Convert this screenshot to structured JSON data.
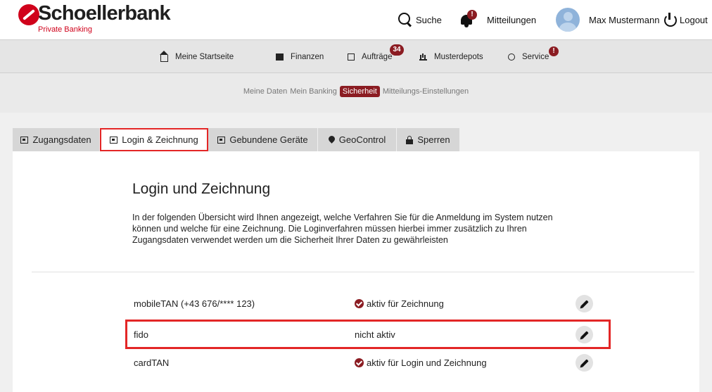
{
  "brand": {
    "name": "Schoellerbank",
    "subtitle": "Private Banking"
  },
  "header": {
    "search_label": "Suche",
    "notifications_label": "Mitteilungen",
    "notifications_badge": "!",
    "user_name": "Max Mustermann",
    "logout_label": "Logout"
  },
  "main_nav": [
    {
      "label": "Meine Startseite",
      "icon": "home-icon"
    },
    {
      "label": "Finanzen",
      "icon": "finance-icon"
    },
    {
      "label": "Aufträge",
      "icon": "orders-icon",
      "badge": "34"
    },
    {
      "label": "Musterdepots",
      "icon": "chart-bars-icon"
    },
    {
      "label": "Service",
      "icon": "service-icon",
      "badge": "!"
    }
  ],
  "sub_nav": {
    "items": [
      "Meine Daten",
      "Mein Banking",
      "Sicherheit",
      "Mitteilungs-Einstellungen"
    ],
    "active": "Sicherheit"
  },
  "tabs": [
    {
      "label": "Zugangsdaten",
      "icon": "id-card-icon"
    },
    {
      "label": "Login & Zeichnung",
      "icon": "id-card-icon",
      "active": true
    },
    {
      "label": "Gebundene Geräte",
      "icon": "id-card-icon"
    },
    {
      "label": "GeoControl",
      "icon": "map-pin-icon"
    },
    {
      "label": "Sperren",
      "icon": "lock-icon"
    }
  ],
  "content": {
    "title": "Login und Zeichnung",
    "description": "In der folgenden Übersicht wird Ihnen angezeigt, welche Verfahren Sie für die Anmeldung im System nutzen können und welche für eine Zeichnung. Die Loginverfahren müssen hierbei immer zusätzlich zu Ihren Zugangsdaten verwendet werden um die Sicherheit Ihrer Daten zu gewährleisten",
    "methods": [
      {
        "name": "mobileTAN (+43 676/**** 123)",
        "status": "aktiv für Zeichnung",
        "active": true
      },
      {
        "name": "fido",
        "status": "nicht aktiv",
        "active": false
      },
      {
        "name": "cardTAN",
        "status": "aktiv für Login und Zeichnung",
        "active": true
      }
    ]
  },
  "colors": {
    "accent": "#8b1c22",
    "brand_red": "#d0021b",
    "highlight_box": "#e32626"
  }
}
